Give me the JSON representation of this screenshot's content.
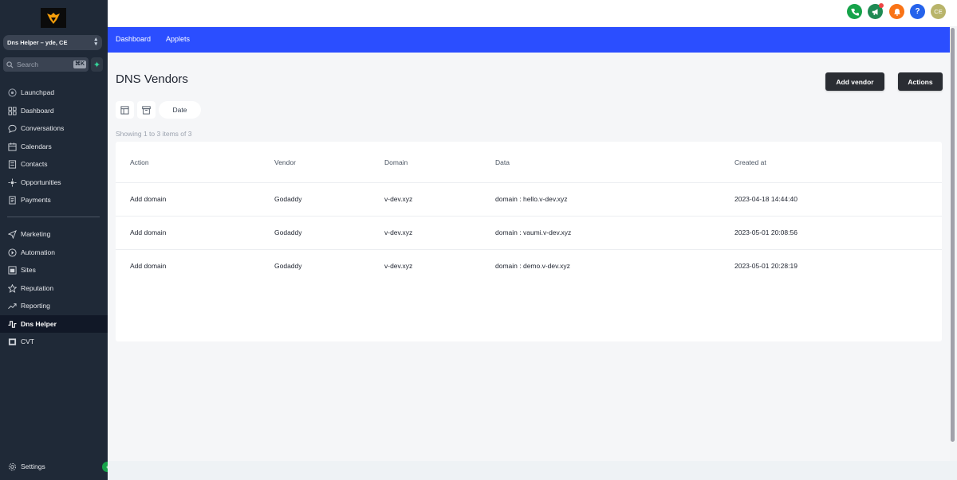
{
  "sidebar": {
    "account": "Dns Helper – yde, CE",
    "search_placeholder": "Search",
    "search_shortcut": "⌘K",
    "items": [
      {
        "label": "Launchpad",
        "icon": "launchpad-icon"
      },
      {
        "label": "Dashboard",
        "icon": "dashboard-icon"
      },
      {
        "label": "Conversations",
        "icon": "chat-icon"
      },
      {
        "label": "Calendars",
        "icon": "calendar-icon"
      },
      {
        "label": "Contacts",
        "icon": "contacts-icon"
      },
      {
        "label": "Opportunities",
        "icon": "opportunities-icon"
      },
      {
        "label": "Payments",
        "icon": "payments-icon"
      },
      {
        "label": "Marketing",
        "icon": "send-icon"
      },
      {
        "label": "Automation",
        "icon": "automation-icon"
      },
      {
        "label": "Sites",
        "icon": "sites-icon"
      },
      {
        "label": "Reputation",
        "icon": "star-icon"
      },
      {
        "label": "Reporting",
        "icon": "trend-icon"
      },
      {
        "label": "Dns Helper",
        "icon": "dns-helper-icon",
        "active": true
      },
      {
        "label": "CVT",
        "icon": "cvt-icon"
      }
    ],
    "settings_label": "Settings"
  },
  "topbar": {
    "avatar_initials": "CE",
    "colors": {
      "phone": "#16a34a",
      "megaphone": "#1f8a53",
      "bell": "#f97316",
      "help": "#2563eb",
      "avatar": "#b8b46a"
    }
  },
  "nav": {
    "dashboard": "Dashboard",
    "applets": "Applets",
    "accent": "#2b4eff"
  },
  "main": {
    "title": "DNS Vendors",
    "add_vendor": "Add vendor",
    "actions": "Actions",
    "date_filter": "Date",
    "showing": "Showing 1 to 3 items of 3"
  },
  "table": {
    "headers": {
      "action": "Action",
      "vendor": "Vendor",
      "domain": "Domain",
      "data": "Data",
      "created": "Created at"
    },
    "rows": [
      {
        "action": "Add domain",
        "vendor": "Godaddy",
        "domain": "v-dev.xyz",
        "data": "domain : hello.v-dev.xyz",
        "created": "2023-04-18 14:44:40"
      },
      {
        "action": "Add domain",
        "vendor": "Godaddy",
        "domain": "v-dev.xyz",
        "data": "domain : vaumi.v-dev.xyz",
        "created": "2023-05-01 20:08:56"
      },
      {
        "action": "Add domain",
        "vendor": "Godaddy",
        "domain": "v-dev.xyz",
        "data": "domain : demo.v-dev.xyz",
        "created": "2023-05-01 20:28:19"
      }
    ]
  }
}
